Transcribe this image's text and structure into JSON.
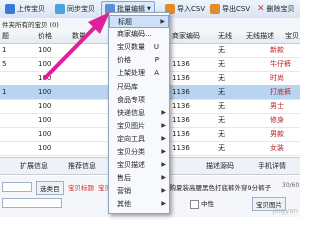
{
  "toolbar": {
    "upload": "上传宝贝",
    "sync": "同步宝贝",
    "batch_edit": "批量编辑",
    "import_csv": "导入CSV",
    "export_csv": "导出CSV",
    "delete": "删除宝贝"
  },
  "subbar": {
    "label": "件夹所有的宝贝 (0)"
  },
  "table": {
    "headers": [
      "题",
      "价格",
      "数量",
      "",
      "商家编码",
      "无线",
      "无线描述",
      "宝贝"
    ],
    "rows": [
      {
        "c0": "1",
        "c1": "100",
        "c2": "",
        "c4": "",
        "c5": "无",
        "c6": "",
        "c7": "新款",
        "selected": false
      },
      {
        "c0": "5",
        "c1": "100",
        "c2": "",
        "c4": "1136",
        "c5": "无",
        "c6": "",
        "c7": "牛仔裤",
        "selected": false
      },
      {
        "c0": "",
        "c1": "100",
        "c2": "",
        "c4": "1136",
        "c5": "无",
        "c6": "",
        "c7": "时尚",
        "selected": false
      },
      {
        "c0": "1",
        "c1": "100",
        "c2": "",
        "c4": "1136",
        "c5": "无",
        "c6": "",
        "c7": "打底裤",
        "selected": true
      },
      {
        "c0": "",
        "c1": "100",
        "c2": "",
        "c4": "1136",
        "c5": "无",
        "c6": "",
        "c7": "男士",
        "selected": false
      },
      {
        "c0": "",
        "c1": "100",
        "c2": "",
        "c4": "1136",
        "c5": "无",
        "c6": "",
        "c7": "修身",
        "selected": false
      },
      {
        "c0": "",
        "c1": "100",
        "c2": "",
        "c4": "1136",
        "c5": "无",
        "c6": "",
        "c7": "男款",
        "selected": false
      },
      {
        "c0": "",
        "c1": "100",
        "c2": "",
        "c4": "1136",
        "c5": "无",
        "c6": "",
        "c7": "女装",
        "selected": false
      }
    ]
  },
  "menu": {
    "items": [
      {
        "label": "标题",
        "submenu": true,
        "key": ""
      },
      {
        "label": "商家编码...",
        "submenu": false,
        "key": ""
      },
      {
        "label": "宝贝数量",
        "submenu": false,
        "key": "U"
      },
      {
        "label": "价格",
        "submenu": false,
        "key": "P"
      },
      {
        "label": "上架处理",
        "submenu": false,
        "key": "A"
      },
      {
        "label": "尺码库",
        "submenu": false,
        "key": ""
      },
      {
        "label": "食品专项",
        "submenu": false,
        "key": ""
      },
      {
        "label": "快递信息",
        "submenu": true,
        "key": ""
      },
      {
        "label": "宝贝图片",
        "submenu": true,
        "key": ""
      },
      {
        "label": "定向工具",
        "submenu": true,
        "key": ""
      },
      {
        "label": "宝贝分类",
        "submenu": true,
        "key": ""
      },
      {
        "label": "宝贝描述",
        "submenu": true,
        "key": ""
      },
      {
        "label": "售后",
        "submenu": true,
        "key": ""
      },
      {
        "label": "营销",
        "submenu": true,
        "key": ""
      },
      {
        "label": "其他",
        "submenu": true,
        "key": ""
      }
    ]
  },
  "tabs": [
    "扩展信息",
    "推荐信息",
    "",
    "描述源码",
    "手机详情"
  ],
  "bottom": {
    "select_label": "选类目",
    "tag1": "宝贝标题",
    "tag2": "宝贝卖点",
    "text": "韩国代购夏装高腰黑色打底裤外穿9分裤子",
    "count": "30/60",
    "right_label": "宝贝图片",
    "check_label": "中性"
  },
  "watermark": "jingyan"
}
